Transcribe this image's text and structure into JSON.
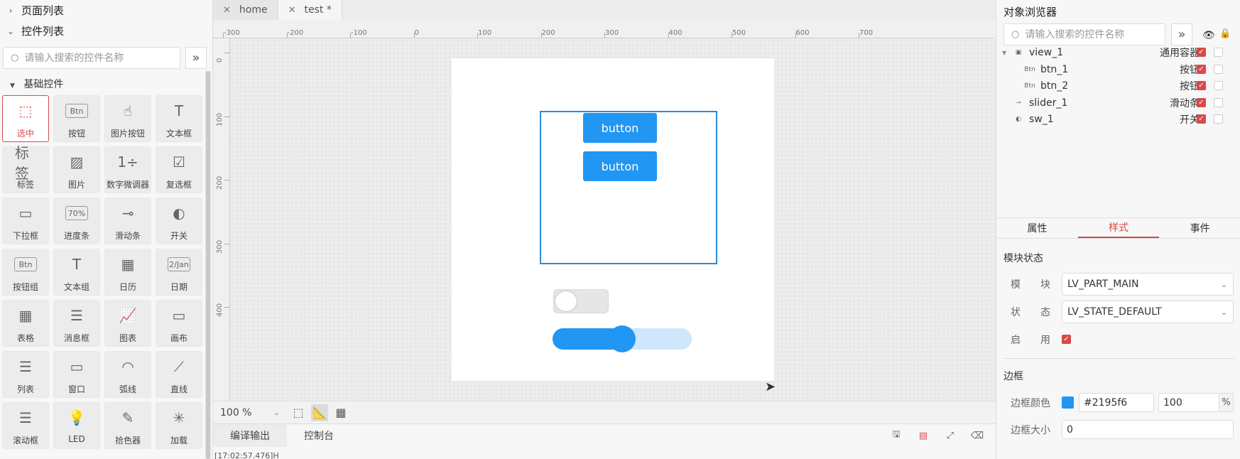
{
  "left_panel": {
    "page_list_label": "页面列表",
    "widget_list_label": "控件列表",
    "search_placeholder": "请输入搜索的控件名称",
    "basic_group_label": "基础控件",
    "widgets": [
      {
        "label": "选中",
        "icon": "select-icon",
        "glyph": "⬚",
        "selected": true
      },
      {
        "label": "按钮",
        "icon": "button-icon",
        "glyph": "Btn"
      },
      {
        "label": "图片按钮",
        "icon": "image-button-icon",
        "glyph": "☝"
      },
      {
        "label": "文本框",
        "icon": "textbox-icon",
        "glyph": "T"
      },
      {
        "label": "标签",
        "icon": "label-icon",
        "glyph": "标签"
      },
      {
        "label": "图片",
        "icon": "image-icon",
        "glyph": "▨"
      },
      {
        "label": "数字微调器",
        "icon": "spinbox-icon",
        "glyph": "1÷"
      },
      {
        "label": "复选框",
        "icon": "checkbox-icon",
        "glyph": "☑"
      },
      {
        "label": "下拉框",
        "icon": "dropdown-icon",
        "glyph": "▭"
      },
      {
        "label": "进度条",
        "icon": "progress-icon",
        "glyph": "70%"
      },
      {
        "label": "滑动条",
        "icon": "slider-icon",
        "glyph": "⊸"
      },
      {
        "label": "开关",
        "icon": "switch-icon",
        "glyph": "◐"
      },
      {
        "label": "按钮组",
        "icon": "button-group-icon",
        "glyph": "Btn"
      },
      {
        "label": "文本组",
        "icon": "text-group-icon",
        "glyph": "T"
      },
      {
        "label": "日历",
        "icon": "calendar-icon",
        "glyph": "▦"
      },
      {
        "label": "日期",
        "icon": "date-icon",
        "glyph": "2/Jan"
      },
      {
        "label": "表格",
        "icon": "table-icon",
        "glyph": "▦"
      },
      {
        "label": "消息框",
        "icon": "message-box-icon",
        "glyph": "☰"
      },
      {
        "label": "图表",
        "icon": "chart-icon",
        "glyph": "📈"
      },
      {
        "label": "画布",
        "icon": "canvas-icon",
        "glyph": "▭"
      },
      {
        "label": "列表",
        "icon": "list-icon",
        "glyph": "☰"
      },
      {
        "label": "窗口",
        "icon": "window-icon",
        "glyph": "▭"
      },
      {
        "label": "弧线",
        "icon": "arc-icon",
        "glyph": "◠"
      },
      {
        "label": "直线",
        "icon": "line-icon",
        "glyph": "⟋"
      },
      {
        "label": "滚动框",
        "icon": "roller-icon",
        "glyph": "☰"
      },
      {
        "label": "LED",
        "icon": "led-icon",
        "glyph": "💡"
      },
      {
        "label": "拾色器",
        "icon": "color-picker-icon",
        "glyph": "✎"
      },
      {
        "label": "加载",
        "icon": "spinner-icon",
        "glyph": "✳"
      }
    ]
  },
  "tabs": [
    {
      "label": "home",
      "active": false
    },
    {
      "label": "test *",
      "active": true
    }
  ],
  "ruler": {
    "top": [
      "-300",
      "-200",
      "-100",
      "0",
      "100",
      "200",
      "300",
      "400",
      "500",
      "600",
      "700"
    ],
    "left": [
      "0",
      "100",
      "200",
      "300",
      "400"
    ]
  },
  "canvas": {
    "button1_label": "button",
    "button2_label": "button",
    "slider_value": 0.5
  },
  "canvas_footer": {
    "zoom": "100 %"
  },
  "output": {
    "tabs": [
      "编译输出",
      "控制台"
    ],
    "log_line": "[17:02:57.476]H"
  },
  "right_panel": {
    "title": "对象浏览器",
    "search_placeholder": "请输入搜索的控件名称",
    "objects": [
      {
        "name": "view_1",
        "type": "通用容器",
        "icon": "container-icon",
        "glyph": "▣",
        "level": 0,
        "expandable": true
      },
      {
        "name": "btn_1",
        "type": "按钮",
        "icon": "button-icon",
        "glyph": "Btn",
        "level": 1
      },
      {
        "name": "btn_2",
        "type": "按钮",
        "icon": "button-icon",
        "glyph": "Btn",
        "level": 1
      },
      {
        "name": "slider_1",
        "type": "滑动条",
        "icon": "slider-icon",
        "glyph": "⊸",
        "level": 0
      },
      {
        "name": "sw_1",
        "type": "开关",
        "icon": "switch-icon",
        "glyph": "◐",
        "level": 0
      }
    ],
    "prop_tabs": [
      "属性",
      "样式",
      "事件"
    ],
    "active_prop_tab": "样式",
    "module_state": {
      "title": "模块状态",
      "part_label": "模　　块",
      "part_value": "LV_PART_MAIN",
      "state_label": "状　　态",
      "state_value": "LV_STATE_DEFAULT",
      "enable_label": "启　　用"
    },
    "border": {
      "title": "边框",
      "color_label": "边框颜色",
      "color_value": "#2195f6",
      "opacity_value": "100",
      "opacity_unit": "%",
      "size_label": "边框大小",
      "size_value": "0"
    }
  },
  "colors": {
    "accent": "#d84a4a",
    "widget_blue": "#2196f3",
    "selection_border": "#2a8bd8"
  }
}
